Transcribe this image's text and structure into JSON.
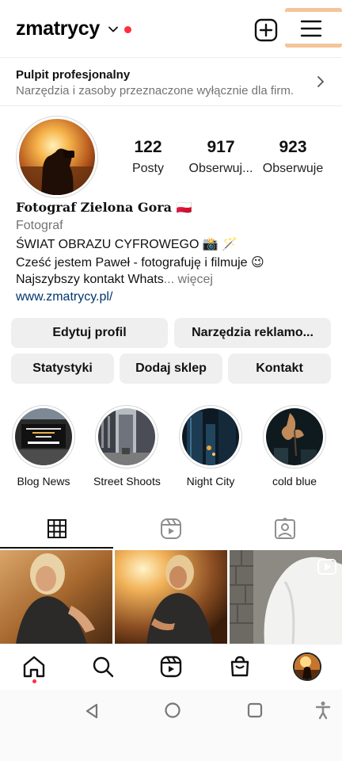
{
  "header": {
    "username": "zmatrycy",
    "add_icon": "plus-square-icon",
    "menu_icon": "hamburger-menu-icon"
  },
  "professional": {
    "title": "Pulpit profesjonalny",
    "subtitle": "Narzędzia i zasoby przeznaczone wyłącznie dla firm."
  },
  "stats": [
    {
      "value": "122",
      "label": "Posty"
    },
    {
      "value": "917",
      "label": "Obserwuj..."
    },
    {
      "value": "923",
      "label": "Obserwuje"
    }
  ],
  "bio": {
    "name": "Fotograf Zielona Gora 🇵🇱",
    "category": "Fotograf",
    "line1": "ŚWIAT OBRAZU CYFROWEGO 📸 🪄",
    "line2": "Cześć jestem Paweł - fotografuję i filmuje 😉",
    "line3": "Najszybszy kontakt Whats",
    "more": "... więcej",
    "link": "www.zmatrycy.pl/"
  },
  "buttons": {
    "edit_profile": "Edytuj profil",
    "ad_tools": "Narzędzia reklamo...",
    "stats": "Statystyki",
    "add_shop": "Dodaj sklep",
    "contact": "Kontakt"
  },
  "highlights": [
    {
      "label": "Blog News"
    },
    {
      "label": "Street Shoots"
    },
    {
      "label": "Night City"
    },
    {
      "label": "cold blue"
    }
  ],
  "tabs": [
    {
      "icon": "grid-icon"
    },
    {
      "icon": "reels-icon"
    },
    {
      "icon": "tagged-icon"
    }
  ],
  "nav": [
    {
      "icon": "home-icon"
    },
    {
      "icon": "search-icon"
    },
    {
      "icon": "reels-icon"
    },
    {
      "icon": "shop-icon"
    },
    {
      "icon": "profile-avatar"
    }
  ],
  "system_nav": [
    {
      "icon": "back-icon"
    },
    {
      "icon": "home-circle-icon"
    },
    {
      "icon": "recents-icon"
    },
    {
      "icon": "accessibility-icon"
    }
  ],
  "colors": {
    "notification_red": "#ff3040",
    "link_blue": "#00376b",
    "button_gray": "#efefef"
  }
}
